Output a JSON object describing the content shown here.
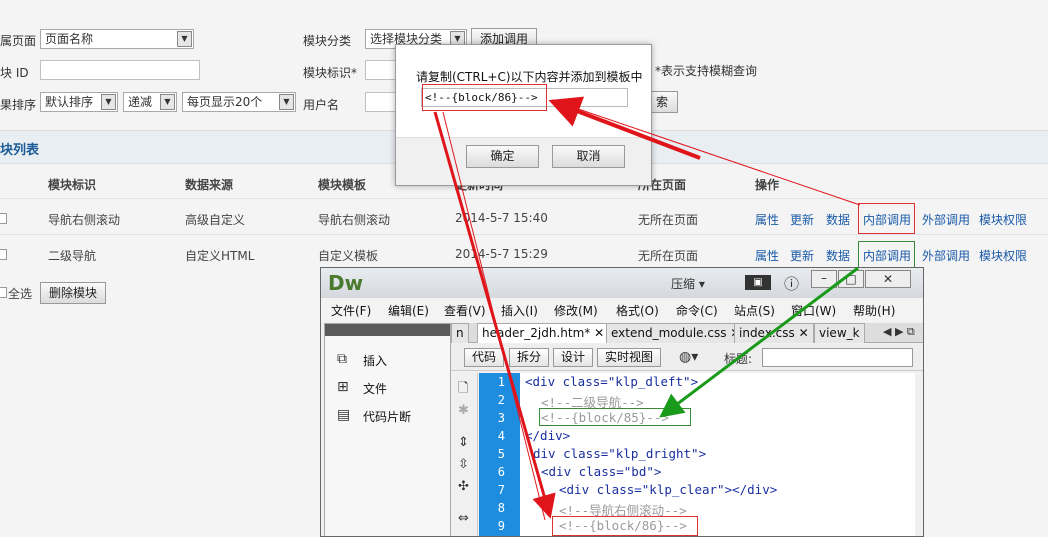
{
  "filters": {
    "page_label": "属页面",
    "page_select": "页面名称",
    "category_label": "模块分类",
    "category_select": "选择模块分类",
    "add_call_button": "添加调用",
    "block_id_label": "块 ID",
    "block_mark_label": "模块标识*",
    "fuzzy_hint": "*表示支持模糊查询",
    "sort_label": "果排序",
    "sort_select": "默认排序",
    "order_select": "递减",
    "pagesize_select": "每页显示20个",
    "user_label": "用户名",
    "search_button": "索"
  },
  "section_title": "块列表",
  "table": {
    "headers": [
      "模块标识",
      "数据来源",
      "模块模板",
      "更新时间",
      "所在页面",
      "操作"
    ],
    "rows": [
      {
        "mark": "导航右侧滚动",
        "source": "高级自定义",
        "template": "导航右侧滚动",
        "time": "2014-5-7 15:40",
        "page": "无所在页面",
        "actions": [
          "属性",
          "更新",
          "数据",
          "内部调用",
          "外部调用",
          "模块权限"
        ]
      },
      {
        "mark": "二级导航",
        "source": "自定义HTML",
        "template": "自定义模板",
        "time": "2014-5-7 15:29",
        "page": "无所在页面",
        "actions": [
          "属性",
          "更新",
          "数据",
          "内部调用",
          "外部调用",
          "模块权限"
        ]
      }
    ],
    "select_all": "全选",
    "delete_button": "删除模块"
  },
  "modal": {
    "message": "请复制(CTRL+C)以下内容并添加到模板中",
    "code_value": "<!--{block/86}-->",
    "ok_button": "确定",
    "cancel_button": "取消"
  },
  "dw": {
    "logo": "Dw",
    "compress": "压缩 ▾",
    "menu": [
      "文件(F)",
      "编辑(E)",
      "查看(V)",
      "插入(I)",
      "修改(M)",
      "格式(O)",
      "命令(C)",
      "站点(S)",
      "窗口(W)",
      "帮助(H)"
    ],
    "panel_items": [
      "插入",
      "文件",
      "代码片断"
    ],
    "tabs": [
      "n",
      "header_2jdh.htm*",
      "extend_module.css",
      "index.css",
      "view_k"
    ],
    "toolbar": {
      "code": "代码",
      "split": "拆分",
      "design": "设计",
      "live": "实时视图",
      "title_label": "标题:"
    },
    "lines": [
      {
        "n": "1",
        "text": "<div class=\"klp_dleft\">",
        "cmt": false,
        "indent": 0
      },
      {
        "n": "2",
        "text": "<!--二级导航-->",
        "cmt": true,
        "indent": 1
      },
      {
        "n": "3",
        "text": "<!--{block/85}-->",
        "cmt": true,
        "indent": 1
      },
      {
        "n": "4",
        "text": "</div>",
        "cmt": false,
        "indent": 0
      },
      {
        "n": "5",
        "text": "div class=\"klp_dright\">",
        "cmt": false,
        "indent": 0
      },
      {
        "n": "6",
        "text": "<div class=\"bd\">",
        "cmt": false,
        "indent": 1
      },
      {
        "n": "7",
        "text": "<div class=\"klp_clear\"></div>",
        "cmt": false,
        "indent": 2
      },
      {
        "n": "8",
        "text": "<!--导航右侧滚动-->",
        "cmt": true,
        "indent": 2
      },
      {
        "n": "9",
        "text": "<!--{block/86}-->",
        "cmt": true,
        "indent": 2
      }
    ]
  }
}
